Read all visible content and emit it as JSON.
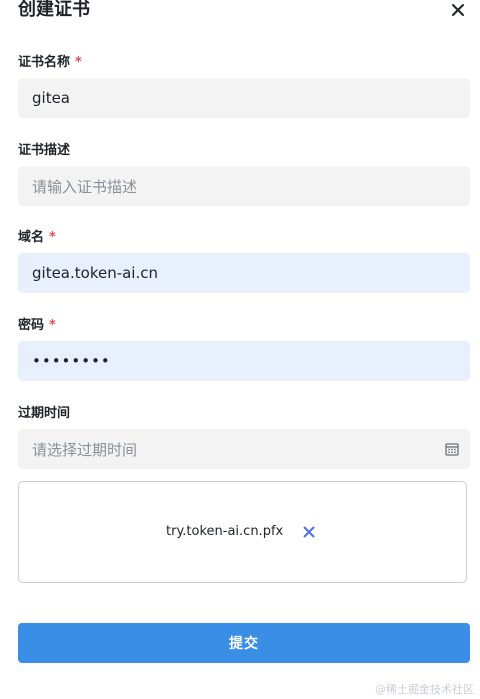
{
  "dialog": {
    "title": "创建证书"
  },
  "fields": {
    "cert_name": {
      "label": "证书名称",
      "required_mark": "*",
      "value": "gitea"
    },
    "cert_desc": {
      "label": "证书描述",
      "placeholder": "请输入证书描述",
      "value": ""
    },
    "domain": {
      "label": "域名",
      "required_mark": "*",
      "value": "gitea.token-ai.cn"
    },
    "password": {
      "label": "密码",
      "required_mark": "*",
      "masked_value": "••••••••"
    },
    "expiry": {
      "label": "过期时间",
      "placeholder": "请选择过期时间",
      "icon": "calendar-icon"
    }
  },
  "upload": {
    "file_name": "try.token-ai.cn.pfx",
    "remove_icon": "close-icon",
    "remove_icon_color": "#4e6ef2"
  },
  "submit": {
    "label": "提交",
    "color": "#3b8ee6"
  },
  "watermark": "@稀土掘金技术社区",
  "colors": {
    "required": "#e34d59",
    "autofill_bg": "#e8f0fe",
    "input_bg": "#f3f3f3"
  }
}
